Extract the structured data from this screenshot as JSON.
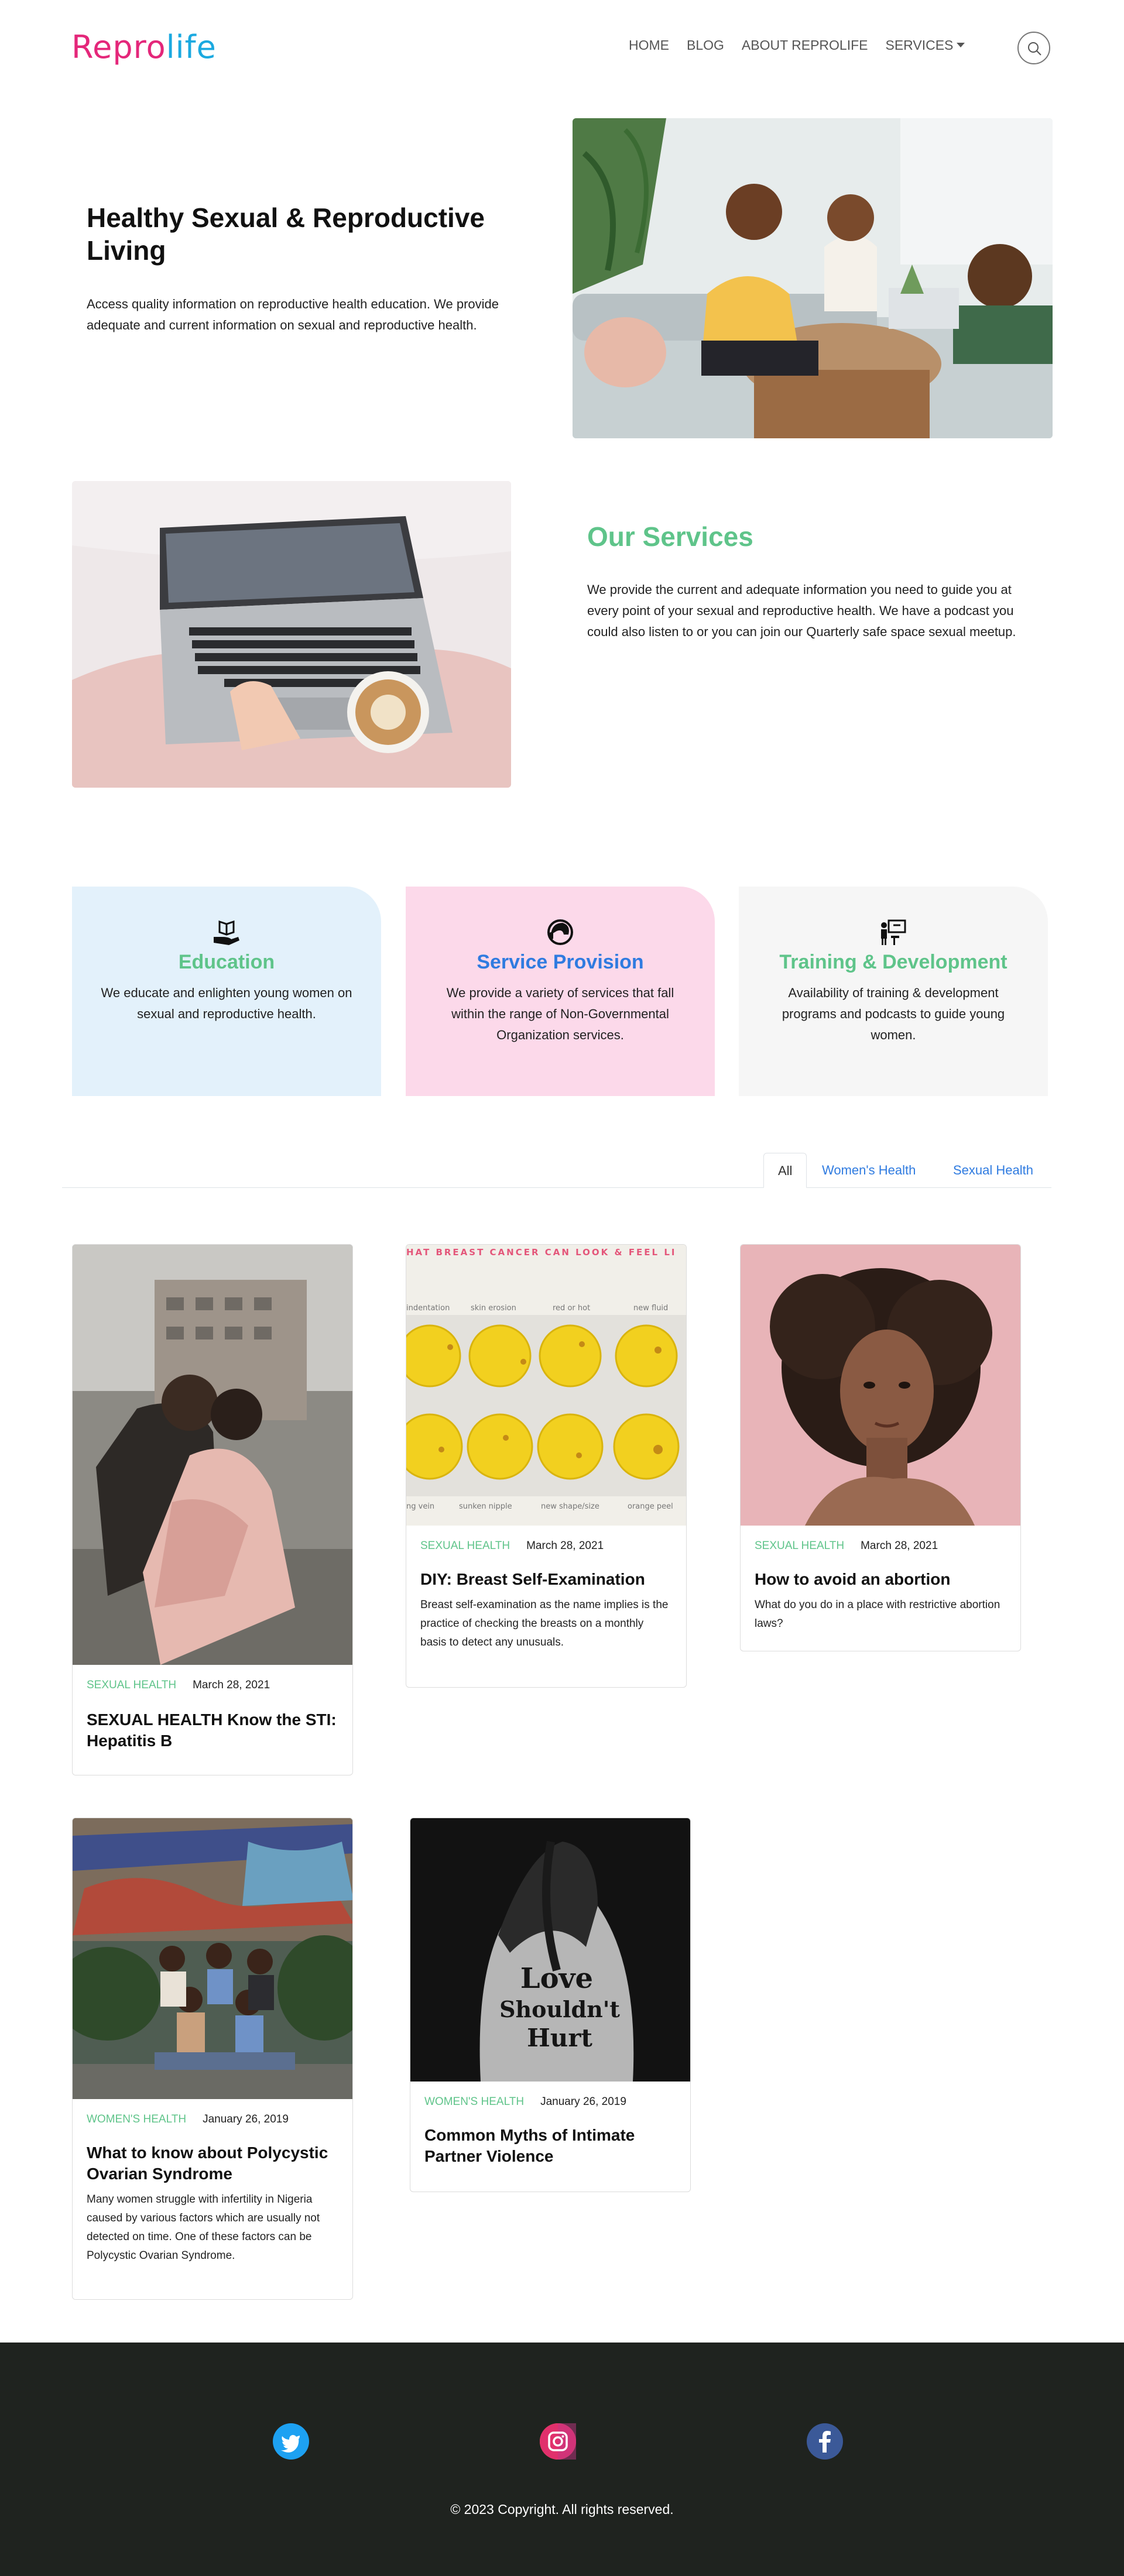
{
  "brand": {
    "logo_part1": "Repr",
    "logo_part2": "o",
    "logo_part3": "life"
  },
  "nav": {
    "items": [
      "HOME",
      "BLOG",
      "ABOUT REPROLIFE",
      "SERVICES"
    ]
  },
  "hero": {
    "title": "Healthy Sexual & Reproductive Living",
    "text": "Access quality information on reproductive health education. We provide adequate and current information on sexual and reproductive health."
  },
  "services": {
    "heading": "Our Services",
    "text": "We provide the current and adequate information you need to guide you at every point of your sexual and reproductive health. We have a podcast you could also listen to or you can join our Quarterly safe space sexual meetup."
  },
  "features": [
    {
      "icon": "book-hand-icon",
      "title": "Education",
      "text": "We educate and enlighten young women on sexual and reproductive health.",
      "bg": "#e3f1fb",
      "title_color": "#5fc48a"
    },
    {
      "icon": "headset-person-icon",
      "title": "Service Provision",
      "text": "We provide a variety of services that fall within the range of Non-Governmental Organization services.",
      "bg": "#fcd9ea",
      "title_color": "#2f7be0"
    },
    {
      "icon": "presenter-icon",
      "title": "Training & Development",
      "text": "Availability of training & development programs and podcasts to guide young women.",
      "bg": "#f6f6f6",
      "title_color": "#5fc48a"
    }
  ],
  "tabs": [
    "All",
    "Women's Health",
    "Sexual Health"
  ],
  "posts": [
    {
      "category": "SEXUAL HEALTH",
      "date": "March 28, 2021",
      "title": "SEXUAL HEALTH Know the STI: Hepatitis B",
      "excerpt": ""
    },
    {
      "category": "SEXUAL HEALTH",
      "date": "March 28, 2021",
      "title": "DIY: Breast Self-Examination",
      "excerpt": "Breast self-examination as the name implies is the practice of checking the breasts on a monthly basis to detect any unusuals."
    },
    {
      "category": "SEXUAL HEALTH",
      "date": "March 28, 2021",
      "title": "How to avoid an abortion",
      "excerpt": "What do you do in a place with restrictive abortion laws?"
    },
    {
      "category": "WOMEN'S HEALTH",
      "date": "January 26, 2019",
      "title": "What to know about Polycystic Ovarian Syndrome",
      "excerpt": "Many women struggle with infertility in Nigeria caused by various factors which are usually not detected on time. One of these factors can be Polycystic Ovarian Syndrome."
    },
    {
      "category": "WOMEN'S HEALTH",
      "date": "January 26, 2019",
      "title": "Common Myths of Intimate Partner Violence",
      "excerpt": ""
    }
  ],
  "breast_banner": "HAT BREAST CANCER CAN LOOK & FEEL LI",
  "breast_labels_top": [
    "indentation",
    "skin erosion",
    "red or hot",
    "new fluid"
  ],
  "breast_labels_bottom": [
    "ng vein",
    "sunken nipple",
    "new shape/size",
    "orange peel"
  ],
  "poster_text": [
    "Love",
    "Shouldn't",
    "Hurt"
  ],
  "footer": {
    "social": [
      "twitter-icon",
      "instagram-icon",
      "facebook-icon"
    ],
    "copyright": "© 2023 Copyright. All rights reserved."
  }
}
